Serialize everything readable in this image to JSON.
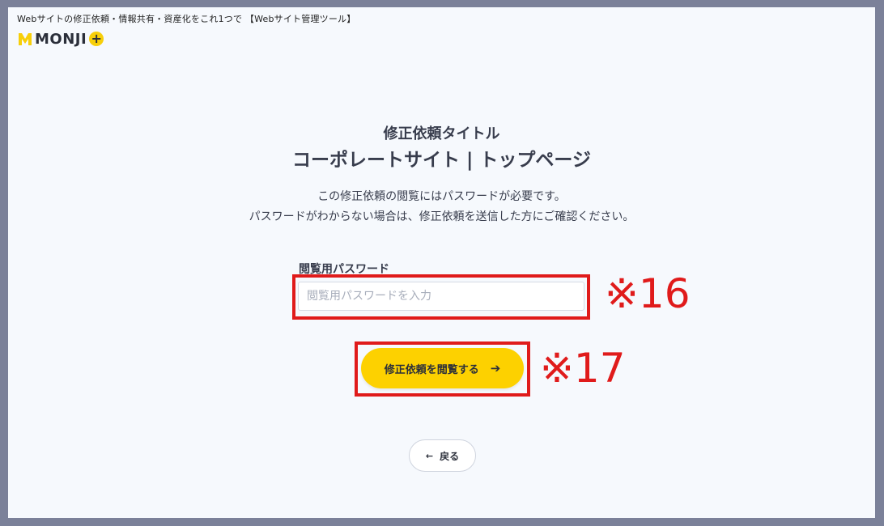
{
  "header": {
    "tagline": "Webサイトの修正依頼・情報共有・資産化をこれ1つで 【Webサイト管理ツール】",
    "logo_text": "MONJI",
    "logo_plus": "+"
  },
  "main": {
    "subtitle": "修正依頼タイトル",
    "title": "コーポレートサイト | トップページ",
    "desc_line1": "この修正依頼の閲覧にはパスワードが必要です。",
    "desc_line2": "パスワードがわからない場合は、修正依頼を送信した方にご確認ください。",
    "password_label": "閲覧用パスワード",
    "password_placeholder": "閲覧用パスワードを入力",
    "password_value": "",
    "view_button_label": "修正依頼を閲覧する",
    "view_button_icon": "arrow-right-icon",
    "back_button_label": "戻る",
    "back_button_icon": "arrow-left-icon"
  },
  "annotations": {
    "note_16": "※16",
    "note_17": "※17",
    "color": "#e01b1b"
  },
  "colors": {
    "background_outer": "#7b8199",
    "background_page": "#f6f9fd",
    "brand_yellow": "#fdd100",
    "text_dark": "#383d4d"
  }
}
